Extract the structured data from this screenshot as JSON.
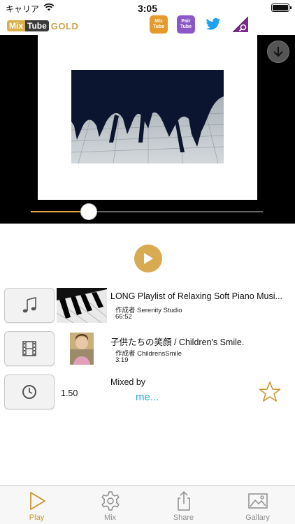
{
  "status_bar": {
    "carrier": "キャリア",
    "time": "3:05"
  },
  "header": {
    "logo": {
      "mix": "Mix",
      "tube": "Tube",
      "gold": "GOLD"
    },
    "icons": [
      {
        "name": "mixtube-app-icon",
        "line1": "Mix",
        "line2": "Tube",
        "color": "#e59a2c"
      },
      {
        "name": "pairtube-app-icon",
        "line1": "Pair",
        "line2": "Tube",
        "color": "#8a58c8"
      },
      {
        "name": "twitter-icon",
        "color": "#1da1f2"
      },
      {
        "name": "search-app-icon",
        "color": "#7a2a88"
      }
    ]
  },
  "player": {
    "progress": 0.25,
    "accent": "#e6a73b"
  },
  "tracks": [
    {
      "icon": "music-note-icon",
      "title": "LONG Playlist of Relaxing Soft Piano Musi...",
      "author": "作成者 Serenity Studio",
      "duration": "66:52"
    },
    {
      "icon": "film-icon",
      "title": "子供たちの笑顔 / Children's Smile.",
      "author": "作成者 ChildrensSmile",
      "duration": "3:19"
    }
  ],
  "speed": {
    "icon": "clock-icon",
    "value": "1.50"
  },
  "mix": {
    "label": "Mixed by",
    "name": "me..."
  },
  "tabs": [
    {
      "label": "Play",
      "icon": "play-tab-icon",
      "active": true
    },
    {
      "label": "Mix",
      "icon": "gear-icon",
      "active": false
    },
    {
      "label": "Share",
      "icon": "share-icon",
      "active": false
    },
    {
      "label": "Gallary",
      "icon": "gallery-icon",
      "active": false
    }
  ],
  "colors": {
    "accent": "#d8ab53",
    "link": "#26a6d9",
    "tab_active": "#c9962e"
  }
}
